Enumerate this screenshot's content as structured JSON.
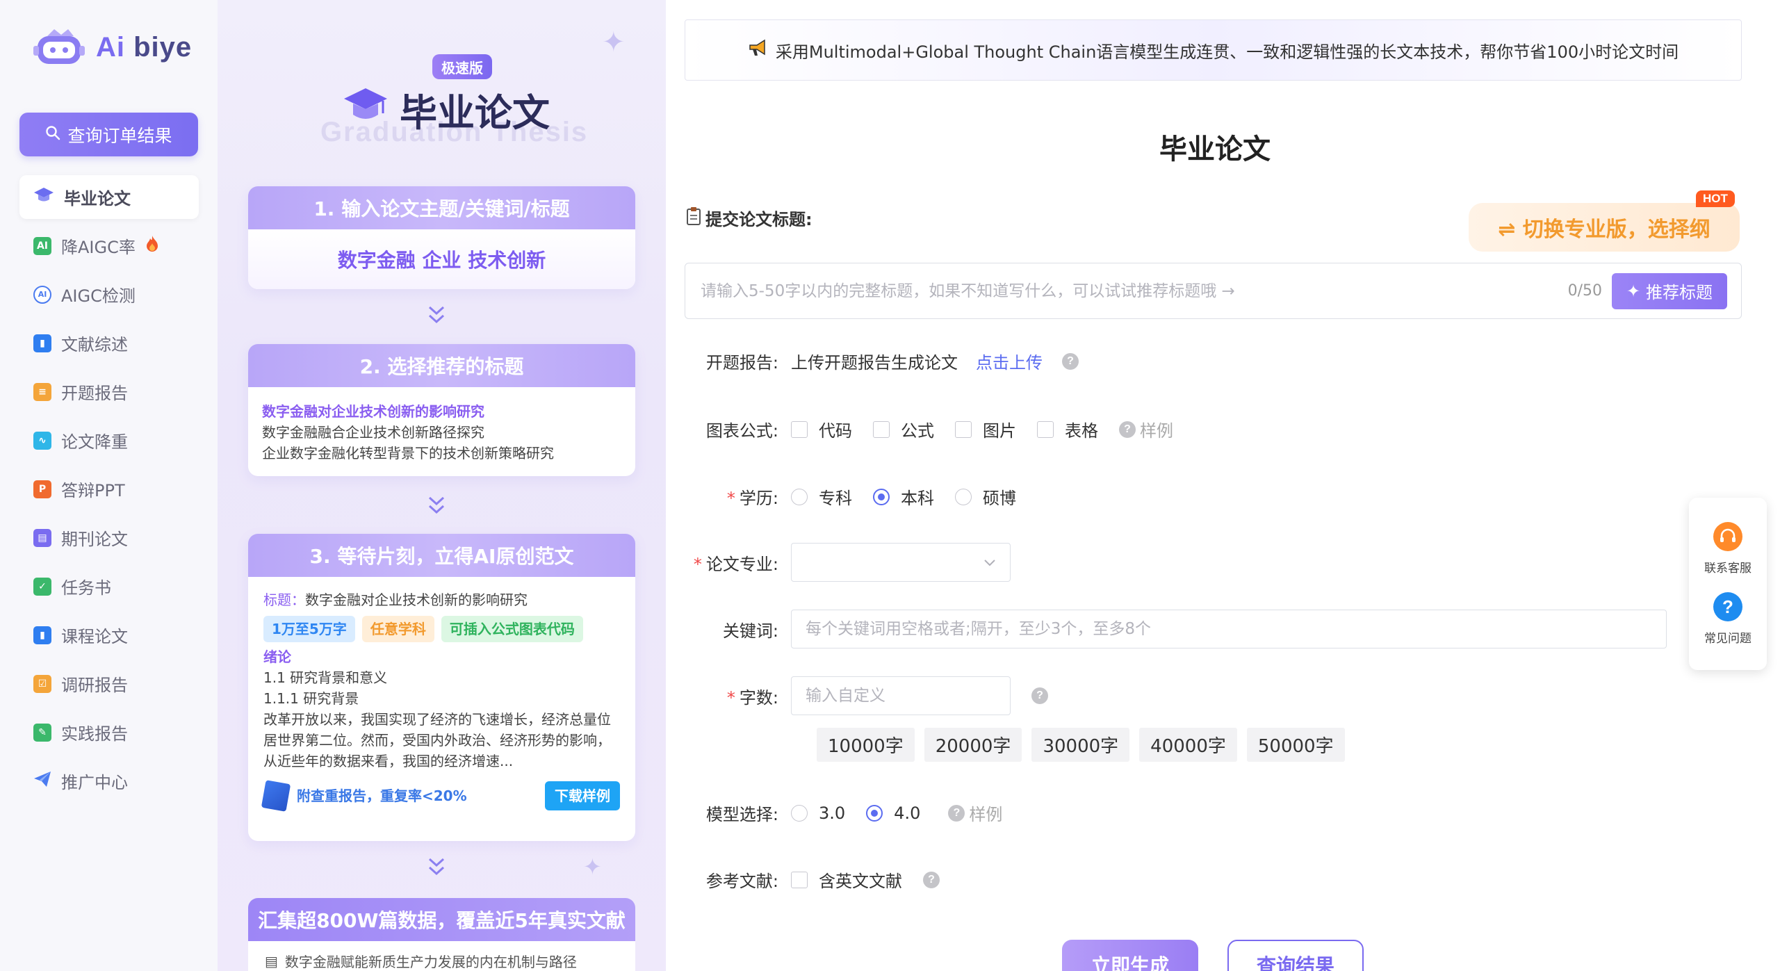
{
  "brand": {
    "logo_text_ai": "Ai",
    "logo_text_rest": " biye"
  },
  "sidebar": {
    "query_button": "查询订单结果",
    "items": [
      {
        "label": "毕业论文",
        "icon": "graduation-cap-icon",
        "color": "#6b6ef0",
        "active": true
      },
      {
        "label": "降AIGC率",
        "icon": "ai-badge-icon",
        "color": "#3bb86b",
        "badge": "fire-icon"
      },
      {
        "label": "AIGC检测",
        "icon": "ai-detect-icon",
        "color": "#4b7bf0"
      },
      {
        "label": "文献综述",
        "icon": "book-icon",
        "color": "#2f7ef0"
      },
      {
        "label": "开题报告",
        "icon": "report-icon",
        "color": "#f4a53a"
      },
      {
        "label": "论文降重",
        "icon": "chart-icon",
        "color": "#2fb6e8"
      },
      {
        "label": "答辩PPT",
        "icon": "ppt-icon",
        "color": "#f06a2e"
      },
      {
        "label": "期刊论文",
        "icon": "journal-icon",
        "color": "#7a6cf0"
      },
      {
        "label": "任务书",
        "icon": "task-icon",
        "color": "#3bb86b"
      },
      {
        "label": "课程论文",
        "icon": "course-icon",
        "color": "#2f7ef0"
      },
      {
        "label": "调研报告",
        "icon": "survey-icon",
        "color": "#f4a53a"
      },
      {
        "label": "实践报告",
        "icon": "practice-icon",
        "color": "#3bb86b"
      },
      {
        "label": "推广中心",
        "icon": "send-icon",
        "color": "#4b7bf0"
      }
    ]
  },
  "promo": {
    "badge": "极速版",
    "title": "毕业论文",
    "subtitle": "Graduation Thesis",
    "step1": {
      "head": "1. 输入论文主题/关键词/标题",
      "body": "数字金融 企业 技术创新"
    },
    "step2": {
      "head": "2. 选择推荐的标题",
      "lines": [
        "数字金融对企业技术创新的影响研究",
        "数字金融融合企业技术创新路径探究",
        "企业数字金融化转型背景下的技术创新策略研究"
      ]
    },
    "step3": {
      "head": "3. 等待片刻，立得AI原创范文",
      "title_label": "标题：",
      "title_value": "数字金融对企业技术创新的影响研究",
      "tags": [
        "1万至5万字",
        "任意学科",
        "可插入公式图表代码"
      ],
      "section": "绪论",
      "lines": [
        "1.1 研究背景和意义",
        "1.1.1 研究背景",
        "改革开放以来，我国实现了经济的飞速增长，经济总量位居世界第二位。然而，受国内外政治、经济形势的影响，从近些年的数据来看，我国的经济增速..."
      ],
      "foot_text": "附查重报告，重复率<20%",
      "download": "下载样例"
    },
    "step4": {
      "head": "汇集超800W篇数据，覆盖近5年真实文献",
      "line": "数字金融赋能新质生产力发展的内在机制与路径"
    }
  },
  "main": {
    "banner": "采用Multimodal+Global Thought Chain语言模型生成连贯、一致和逻辑性强的长文本技术，帮你节省100小时论文时间",
    "title": "毕业论文",
    "submit_label": "提交论文标题:",
    "switch_pro": "⇌ 切换专业版，选择纲",
    "hot": "HOT",
    "title_placeholder": "请输入5-50字以内的完整标题，如果不知道写什么，可以试试推荐标题哦 →",
    "counter": "0/50",
    "recommend": "推荐标题",
    "proposal": {
      "label": "开题报告:",
      "text": "上传开题报告生成论文",
      "link": "点击上传"
    },
    "charts": {
      "label": "图表公式:",
      "options": [
        "代码",
        "公式",
        "图片",
        "表格"
      ],
      "sample": "样例"
    },
    "degree": {
      "label": "学历:",
      "options": [
        "专科",
        "本科",
        "硕博"
      ],
      "selected": "本科"
    },
    "major": {
      "label": "论文专业:"
    },
    "keywords": {
      "label": "关键词:",
      "placeholder": "每个关键词用空格或者;隔开，至少3个，至多8个"
    },
    "wordcount": {
      "label": "字数:",
      "placeholder": "输入自定义",
      "chips": [
        "10000字",
        "20000字",
        "30000字",
        "40000字",
        "50000字"
      ]
    },
    "model": {
      "label": "模型选择:",
      "options": [
        "3.0",
        "4.0"
      ],
      "selected": "4.0",
      "sample": "样例"
    },
    "refs": {
      "label": "参考文献:",
      "option": "含英文文献"
    },
    "generate": "立即生成",
    "query": "查询结果"
  },
  "float": {
    "service": "联系客服",
    "faq": "常见问题"
  }
}
